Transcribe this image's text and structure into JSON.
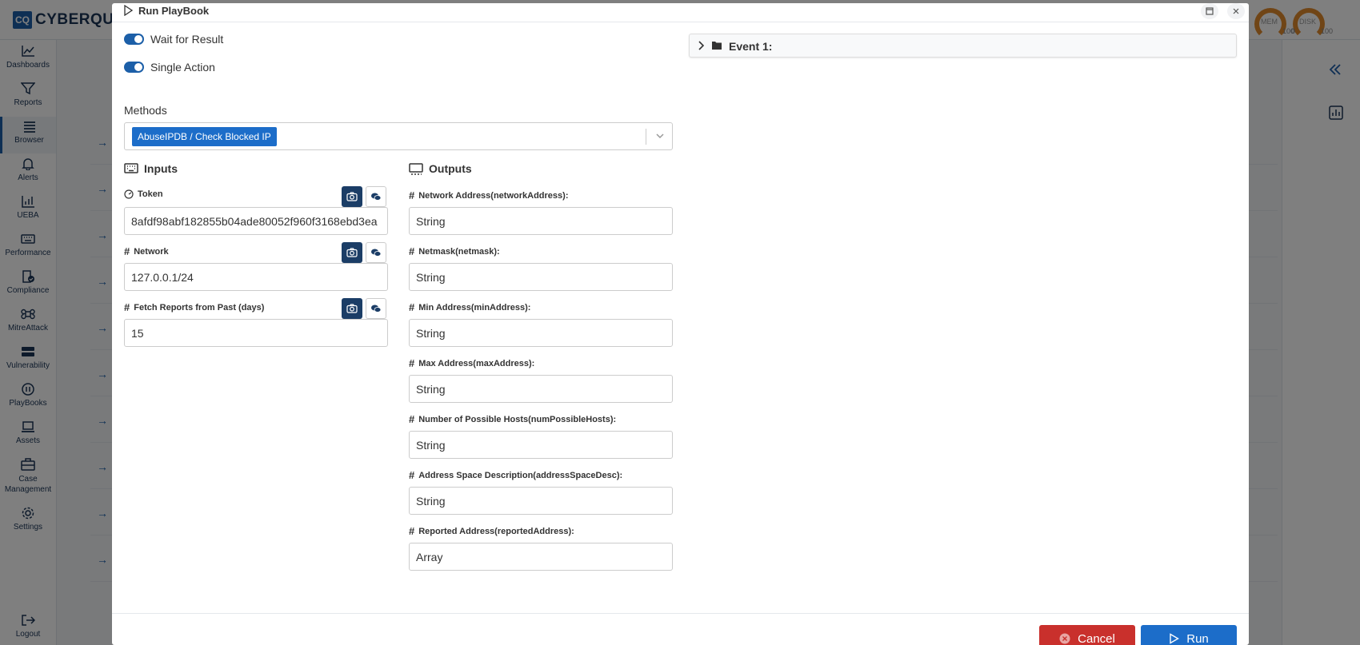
{
  "app": {
    "logo_badge": "CQ",
    "logo_text": "CYBERQUES",
    "gauges": [
      {
        "label": "MEM",
        "min": "",
        "max": "100"
      },
      {
        "label": "DISK",
        "min": "0",
        "max": "100"
      }
    ]
  },
  "sidebar": {
    "items": [
      {
        "label": "Dashboards",
        "icon": "chart-line-icon"
      },
      {
        "label": "Reports",
        "icon": "filter-icon"
      },
      {
        "label": "Browser",
        "icon": "list-icon"
      },
      {
        "label": "Alerts",
        "icon": "bell-icon"
      },
      {
        "label": "UEBA",
        "icon": "bar-chart-icon"
      },
      {
        "label": "Performance",
        "icon": "keyboard-icon"
      },
      {
        "label": "Compliance",
        "icon": "compliance-icon"
      },
      {
        "label": "MitreAttack",
        "icon": "command-icon"
      },
      {
        "label": "Vulnerability",
        "icon": "server-icon"
      },
      {
        "label": "PlayBooks",
        "icon": "playbook-icon"
      },
      {
        "label": "Assets",
        "icon": "laptop-icon"
      },
      {
        "label": "Case\nManagement",
        "icon": "briefcase-icon"
      },
      {
        "label": "Settings",
        "icon": "gear-icon"
      },
      {
        "label": "Logout",
        "icon": "logout-icon"
      }
    ]
  },
  "modal": {
    "title": "Run PlayBook",
    "toggles": [
      {
        "label": "Wait for Result",
        "on": true
      },
      {
        "label": "Single Action",
        "on": true
      }
    ],
    "methods_label": "Methods",
    "selected_method": "AbuseIPDB / Check Blocked IP",
    "inputs_title": "Inputs",
    "outputs_title": "Outputs",
    "inputs": [
      {
        "label": "Token",
        "value": "8afdf98abf182855b04ade80052f960f3168ebd3ea"
      },
      {
        "label": "Network",
        "value": "127.0.0.1/24"
      },
      {
        "label": "Fetch Reports from Past (days)",
        "value": "15"
      }
    ],
    "outputs": [
      {
        "label": "Network Address(networkAddress):",
        "value": "String"
      },
      {
        "label": "Netmask(netmask):",
        "value": "String"
      },
      {
        "label": "Min Address(minAddress):",
        "value": "String"
      },
      {
        "label": "Max Address(maxAddress):",
        "value": "String"
      },
      {
        "label": "Number of Possible Hosts(numPossibleHosts):",
        "value": "String"
      },
      {
        "label": "Address Space Description(addressSpaceDesc):",
        "value": "String"
      },
      {
        "label": "Reported Address(reportedAddress):",
        "value": "Array"
      }
    ],
    "event_label": "Event 1:",
    "cancel_label": "Cancel",
    "run_label": "Run"
  },
  "colors": {
    "primary": "#1c6dc9",
    "danger": "#c9302c",
    "dark_button": "#1b3d66"
  }
}
